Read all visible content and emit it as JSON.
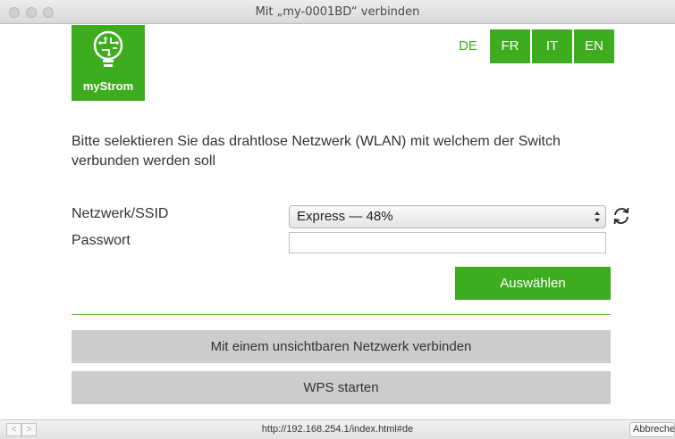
{
  "window": {
    "title": "Mit „my-0001BD“ verbinden"
  },
  "brand": {
    "name": "myStrom",
    "color": "#3dac1e",
    "icon": "lightbulb-circuit-icon"
  },
  "languages": [
    {
      "code": "DE",
      "active": true
    },
    {
      "code": "FR",
      "active": false
    },
    {
      "code": "IT",
      "active": false
    },
    {
      "code": "EN",
      "active": false
    }
  ],
  "intro": "Bitte selektieren Sie das drahtlose Netzwerk (WLAN) mit welchem der Switch verbunden werden soll",
  "form": {
    "ssid_label": "Netzwerk/SSID",
    "ssid_value": "Express — 48%",
    "password_label": "Passwort",
    "password_value": "",
    "submit_label": "Auswählen"
  },
  "actions": {
    "hidden_network_label": "Mit einem unsichtbaren Netzwerk verbinden",
    "wps_label": "WPS starten"
  },
  "statusbar": {
    "url": "http://192.168.254.1/index.html#de",
    "cancel_label": "Abbrechen",
    "back": "<",
    "forward": ">"
  }
}
